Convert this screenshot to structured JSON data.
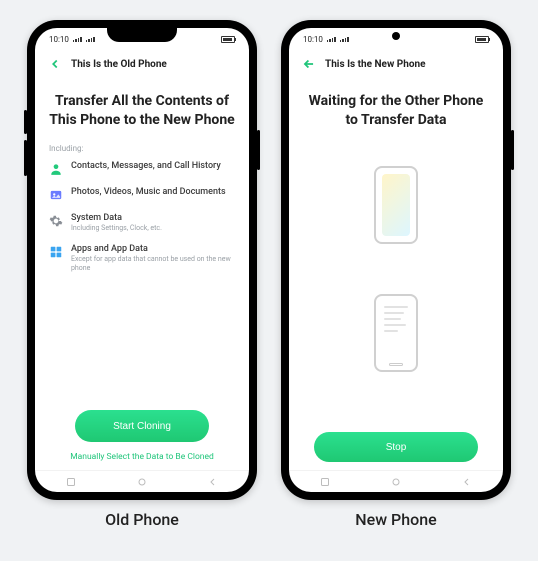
{
  "status": {
    "time": "10:10"
  },
  "old": {
    "caption": "Old Phone",
    "header": "This Is the Old Phone",
    "heading": "Transfer All the Contents of This Phone to the New Phone",
    "including_label": "Including:",
    "items": [
      {
        "title": "Contacts, Messages, and Call History",
        "sub": ""
      },
      {
        "title": "Photos, Videos, Music and Documents",
        "sub": ""
      },
      {
        "title": "System Data",
        "sub": "Including Settings, Clock, etc."
      },
      {
        "title": "Apps and App Data",
        "sub": "Except for app data that cannot be used on the new phone"
      }
    ],
    "primary_btn": "Start Cloning",
    "secondary_link": "Manually Select the Data to Be Cloned"
  },
  "new": {
    "caption": "New Phone",
    "header": "This Is the New Phone",
    "heading": "Waiting for the Other Phone to Transfer Data",
    "stop_btn": "Stop"
  },
  "colors": {
    "accent": "#1fc873"
  }
}
